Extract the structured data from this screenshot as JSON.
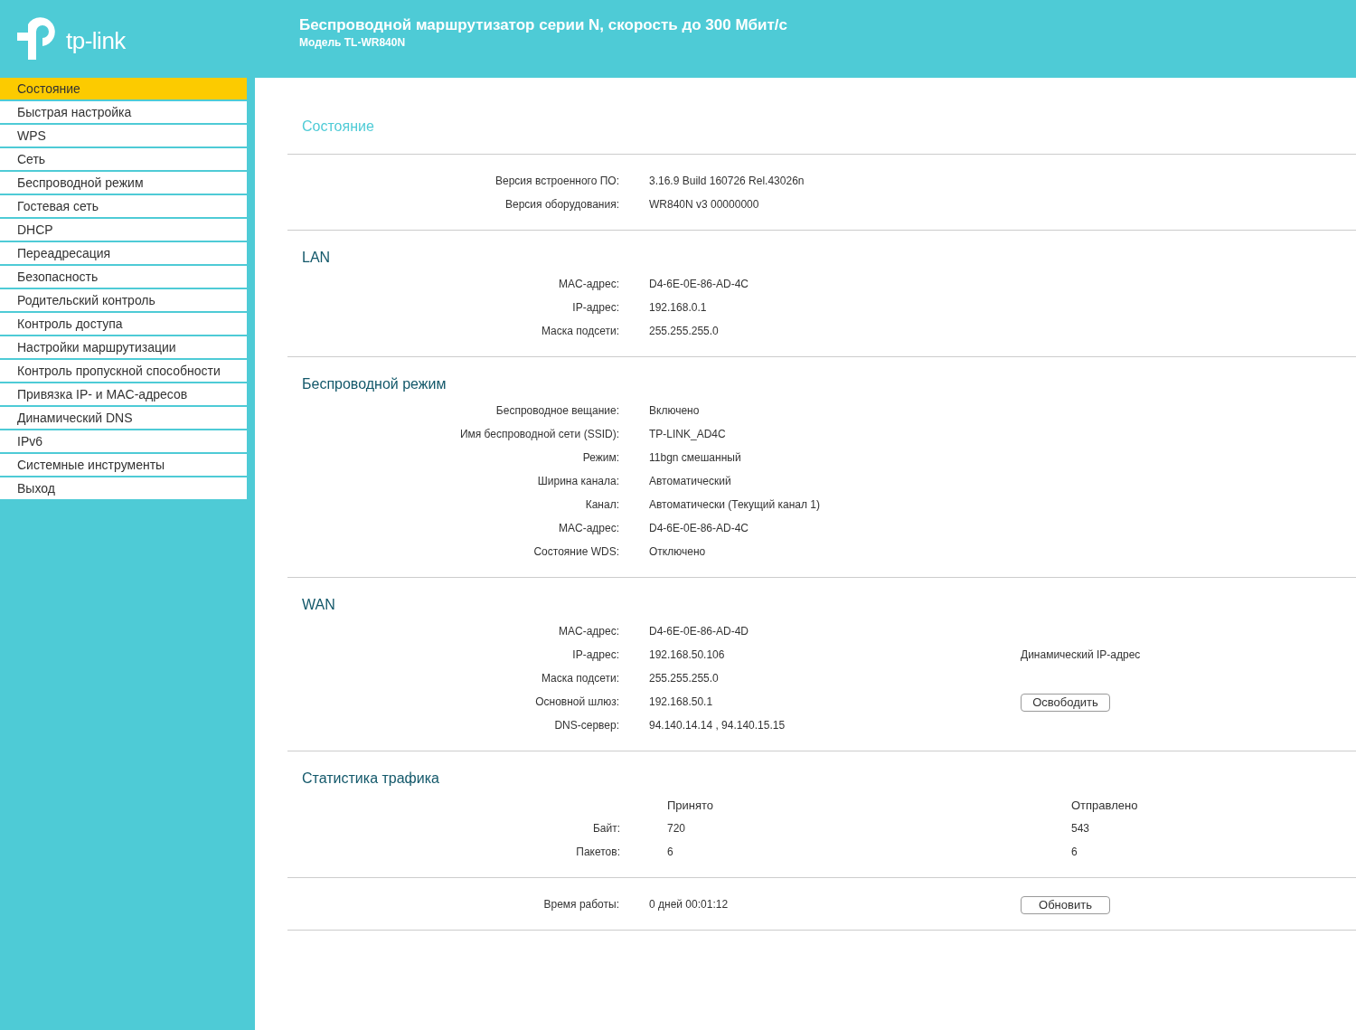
{
  "header": {
    "brand": "tp-link",
    "title": "Беспроводной маршрутизатор серии N, скорость до 300 Мбит/с",
    "model": "Модель TL-WR840N"
  },
  "sidebar": {
    "items": [
      {
        "label": "Состояние",
        "selected": true
      },
      {
        "label": "Быстрая настройка",
        "selected": false
      },
      {
        "label": "WPS",
        "selected": false
      },
      {
        "label": "Сеть",
        "selected": false
      },
      {
        "label": "Беспроводной режим",
        "selected": false
      },
      {
        "label": "Гостевая сеть",
        "selected": false
      },
      {
        "label": "DHCP",
        "selected": false
      },
      {
        "label": "Переадресация",
        "selected": false
      },
      {
        "label": "Безопасность",
        "selected": false
      },
      {
        "label": "Родительский контроль",
        "selected": false
      },
      {
        "label": "Контроль доступа",
        "selected": false
      },
      {
        "label": "Настройки маршрутизации",
        "selected": false
      },
      {
        "label": "Контроль пропускной способности",
        "selected": false
      },
      {
        "label": "Привязка IP- и MAC-адресов",
        "selected": false
      },
      {
        "label": "Динамический DNS",
        "selected": false
      },
      {
        "label": "IPv6",
        "selected": false
      },
      {
        "label": "Системные инструменты",
        "selected": false
      },
      {
        "label": "Выход",
        "selected": false
      }
    ]
  },
  "page_title": "Состояние",
  "sections": [
    {
      "kind": "fields",
      "rows": [
        {
          "label": "Версия встроенного ПО:",
          "value": "3.16.9 Build 160726 Rel.43026n"
        },
        {
          "label": "Версия оборудования:",
          "value": "WR840N v3 00000000"
        }
      ]
    },
    {
      "kind": "fields",
      "title": "LAN",
      "rows": [
        {
          "label": "MAC-адрес:",
          "value": "D4-6E-0E-86-AD-4C"
        },
        {
          "label": "IP-адрес:",
          "value": "192.168.0.1"
        },
        {
          "label": "Маска подсети:",
          "value": "255.255.255.0"
        }
      ]
    },
    {
      "kind": "fields",
      "title": "Беспроводной режим",
      "rows": [
        {
          "label": "Беспроводное вещание:",
          "value": "Включено"
        },
        {
          "label": "Имя беспроводной сети (SSID):",
          "value": "TP-LINK_AD4C"
        },
        {
          "label": "Режим:",
          "value": "11bgn смешанный"
        },
        {
          "label": "Ширина канала:",
          "value": "Автоматический"
        },
        {
          "label": "Канал:",
          "value": "Автоматически (Текущий канал 1)"
        },
        {
          "label": "MAC-адрес:",
          "value": "D4-6E-0E-86-AD-4C"
        },
        {
          "label": "Состояние WDS:",
          "value": "Отключено"
        }
      ]
    },
    {
      "kind": "fields",
      "title": "WAN",
      "rows": [
        {
          "label": "MAC-адрес:",
          "value": "D4-6E-0E-86-AD-4D"
        },
        {
          "label": "IP-адрес:",
          "value": "192.168.50.106",
          "extra": {
            "kind": "note",
            "text": "Динамический IP-адрес"
          }
        },
        {
          "label": "Маска подсети:",
          "value": "255.255.255.0"
        },
        {
          "label": "Основной шлюз:",
          "value": "192.168.50.1",
          "extra": {
            "kind": "button",
            "text": "Освободить"
          }
        },
        {
          "label": "DNS-сервер:",
          "value": "94.140.14.14 , 94.140.15.15"
        }
      ]
    },
    {
      "kind": "traffic",
      "title": "Статистика трафика",
      "columns": [
        "Принято",
        "Отправлено"
      ],
      "rows": [
        {
          "label": "Байт:",
          "values": [
            "720",
            "543"
          ]
        },
        {
          "label": "Пакетов:",
          "values": [
            "6",
            "6"
          ]
        }
      ]
    },
    {
      "kind": "fields",
      "rows": [
        {
          "label": "Время работы:",
          "value": "0 дней 00:01:12",
          "extra": {
            "kind": "button",
            "text": "Обновить"
          }
        }
      ]
    }
  ]
}
